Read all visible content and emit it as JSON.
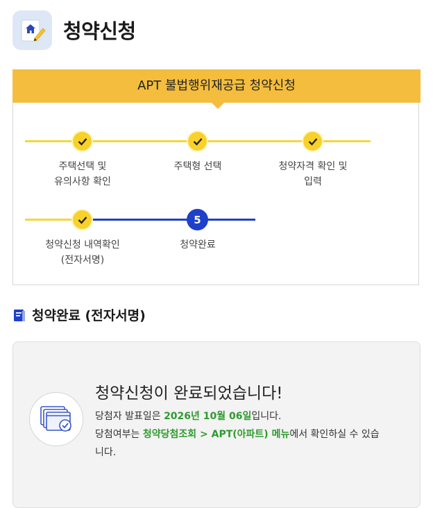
{
  "header": {
    "title": "청약신청"
  },
  "banner": {
    "title": "APT 불법행위재공급 청약신청"
  },
  "steps": [
    {
      "label_line1": "주택선택 및",
      "label_line2": "유의사항 확인",
      "state": "done"
    },
    {
      "label_line1": "주택형 선택",
      "label_line2": "",
      "state": "done"
    },
    {
      "label_line1": "청약자격 확인 및",
      "label_line2": "입력",
      "state": "done"
    },
    {
      "label_line1": "청약신청 내역확인",
      "label_line2": "(전자서명)",
      "state": "done"
    },
    {
      "label_line1": "청약완료",
      "label_line2": "",
      "state": "current",
      "number": "5"
    }
  ],
  "section": {
    "title": "청약완료 (전자서명)"
  },
  "complete": {
    "heading": "청약신청이 완료되었습니다!",
    "line1_pre": "당첨자 발표일은 ",
    "announce_date": "2026년 10월 06일",
    "line1_post": "입니다.",
    "line2_pre": "당첨여부는 ",
    "menu_path": "청약당첨조회 > APT(아파트) 메뉴",
    "line2_post": "에서 확인하실 수 있습니다."
  },
  "colors": {
    "banner": "#f4bd3d",
    "done": "#f8d12b",
    "current": "#1f40c9",
    "highlight": "#2e9b2e"
  }
}
